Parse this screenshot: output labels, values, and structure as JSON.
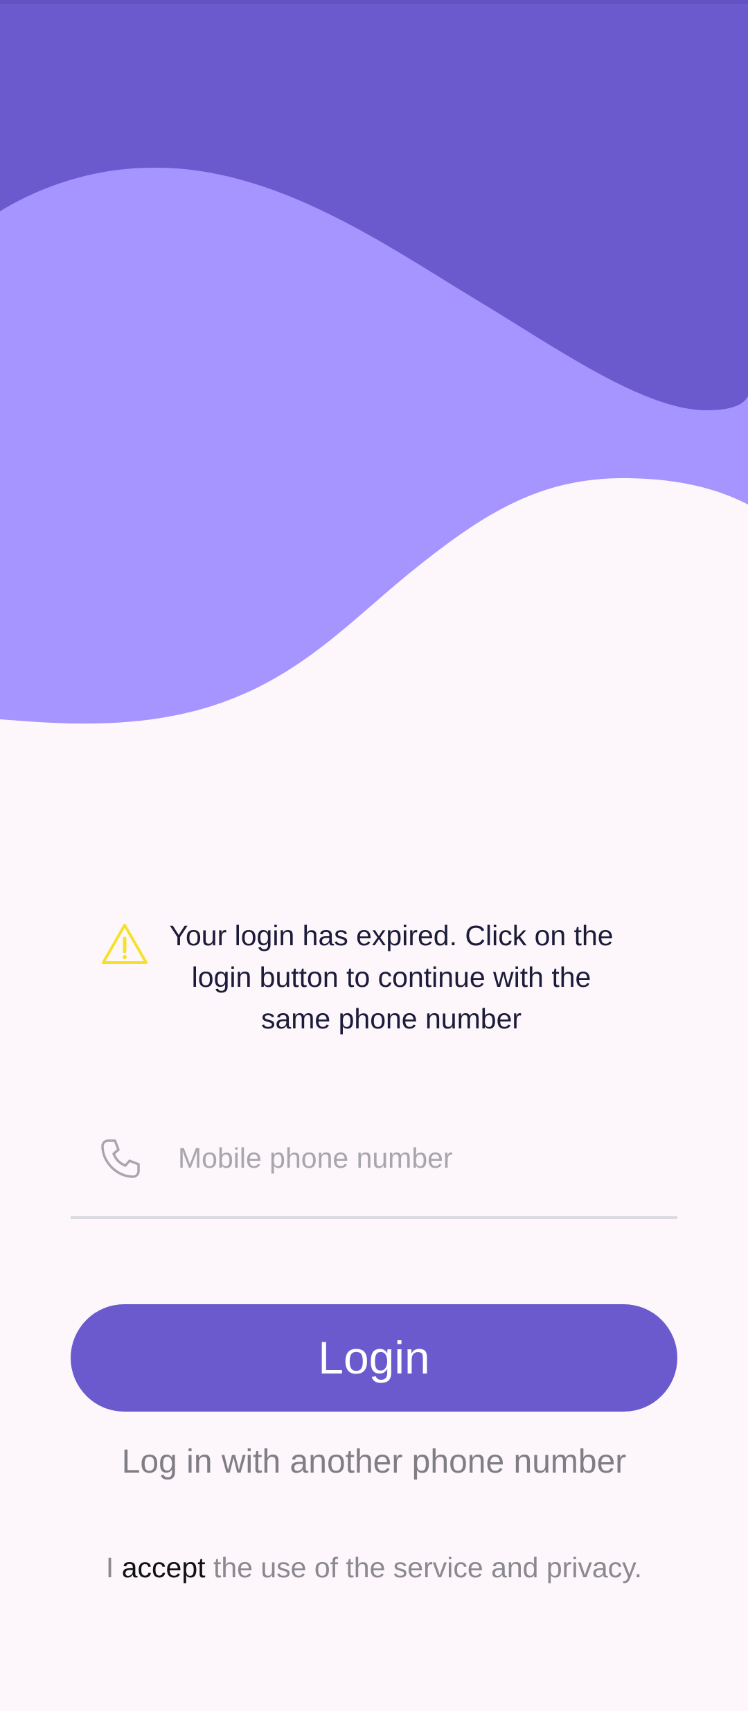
{
  "colors": {
    "background": "#fdf7fc",
    "wave_dark": "#6a5acd",
    "wave_light": "#a694ff",
    "accent": "#6a5acd",
    "warning": "#f5e12a"
  },
  "notice": {
    "icon": "warning-icon",
    "message": "Your login has expired. Click on the login button to continue with the same phone number"
  },
  "phone_input": {
    "icon": "phone-icon",
    "placeholder": "Mobile phone number",
    "value": ""
  },
  "login_button": {
    "label": "Login"
  },
  "alt_login": {
    "label": "Log in with another phone number"
  },
  "terms": {
    "prefix": "I",
    "link": "accept",
    "suffix": "the use of the service and privacy."
  }
}
